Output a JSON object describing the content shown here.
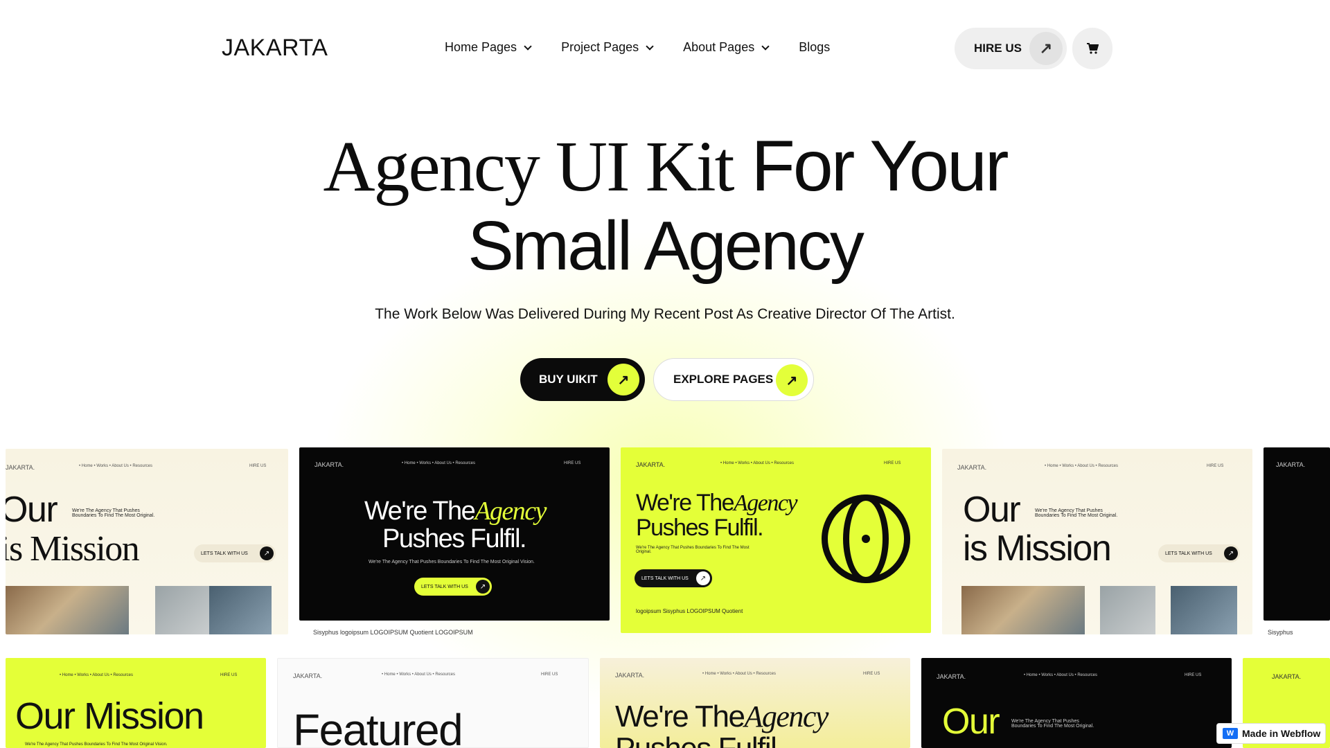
{
  "nav": {
    "logo": "JAKARTA",
    "items": [
      {
        "label": "Home Pages"
      },
      {
        "label": "Project Pages"
      },
      {
        "label": "About Pages"
      },
      {
        "label": "Blogs"
      }
    ],
    "hire_label": "HIRE US",
    "hire_icon": "arrow-up-right-icon",
    "cart_icon": "cart-icon"
  },
  "hero": {
    "title_serif": "Agency UI Kit",
    "title_sans": "For Your",
    "title_line2": "Small Agency",
    "subtitle": "The Work Below Was Delivered During My Recent Post As Creative Director Of The Artist.",
    "buy_label": "BUY UIKIT",
    "explore_label": "EXPLORE PAGES"
  },
  "previews": {
    "logo_small": "JAKARTA.",
    "nav_small": "• Home   • Works   • About Us   • Resources",
    "hire_small": "HIRE US",
    "talk": "LETS TALK WITH US",
    "our": "Our",
    "is_mission": "is Mission",
    "agency_tag": "We're The Agency That Pushes Boundaries To Find The Most Original.",
    "were_the": "We're The",
    "agency": "Agency",
    "pushes": "Pushes Fulfil.",
    "pushes_partial": "Pushes Fulfil",
    "our_mission": "Our Mission",
    "featured": "Featured",
    "our_mission_tag": "We're The Agency That Pushes Boundaries To Find The Most Original Vision.",
    "brands": "Sisyphus   logoipsum   LOGOIPSUM   Quotient   LOGOIPSUM",
    "brands_lime": "logoipsum   Sisyphus   LOGOIPSUM   Quotient",
    "sisyphus": "Sisyphus"
  },
  "badge": {
    "label": "Made in Webflow",
    "icon": "webflow-icon"
  },
  "colors": {
    "accent": "#e4ff38",
    "dark": "#0b0b0b"
  }
}
